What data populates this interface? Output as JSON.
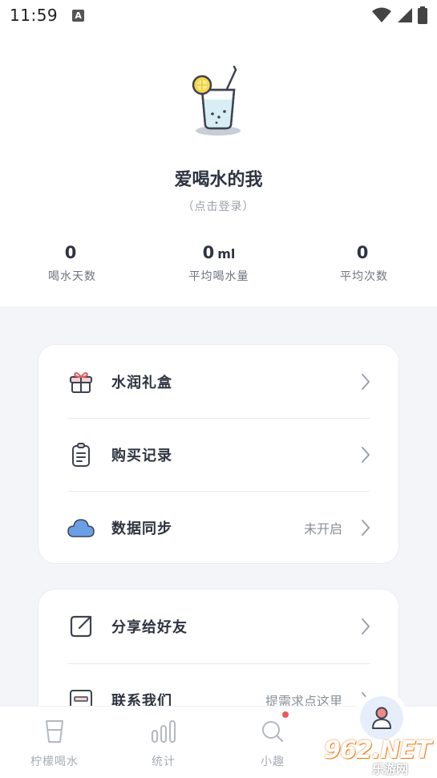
{
  "status_bar": {
    "time": "11:59",
    "notification_glyph": "A"
  },
  "profile": {
    "nickname": "爱喝水的我",
    "login_hint": "（点击登录）",
    "stats": [
      {
        "value": "0",
        "unit": "",
        "label": "喝水天数"
      },
      {
        "value": "0",
        "unit": "ml",
        "label": "平均喝水量"
      },
      {
        "value": "0",
        "unit": "",
        "label": "平均次数"
      }
    ]
  },
  "menu_card_1": [
    {
      "icon": "gift-box-icon",
      "label": "水润礼盒",
      "value": ""
    },
    {
      "icon": "clipboard-icon",
      "label": "购买记录",
      "value": ""
    },
    {
      "icon": "cloud-icon",
      "label": "数据同步",
      "value": "未开启"
    }
  ],
  "menu_card_2": [
    {
      "icon": "share-icon",
      "label": "分享给好友",
      "value": ""
    },
    {
      "icon": "contact-icon",
      "label": "联系我们",
      "value": "提需求点这里"
    }
  ],
  "tabbar": [
    {
      "icon": "cup-icon",
      "label": "柠檬喝水"
    },
    {
      "icon": "stats-icon",
      "label": "统计"
    },
    {
      "icon": "search-icon",
      "label": "小趣",
      "badge": true
    },
    {
      "icon": "person-icon",
      "label": "",
      "active": true
    }
  ],
  "watermark": {
    "brand": "962.NET",
    "sub": "乐游网"
  },
  "colors": {
    "accent": "#5b8fe0",
    "cloud": "#6a9fe6",
    "badge": "#e85b5b",
    "text": "#2e3440",
    "muted": "#a7adb5"
  }
}
